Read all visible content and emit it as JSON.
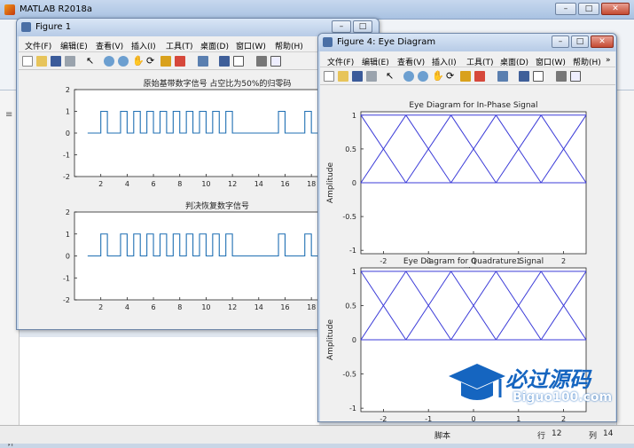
{
  "main_window": {
    "title": "MATLAB R2018a",
    "status_script": "脚本",
    "status_row_label": "行",
    "status_row": "12",
    "status_col_label": "列",
    "status_col": "14",
    "left_clip_label": "评"
  },
  "figure1": {
    "title": "Figure 1",
    "menu": [
      "文件(F)",
      "编辑(E)",
      "查看(V)",
      "插入(I)",
      "工具(T)",
      "桌面(D)",
      "窗口(W)",
      "帮助(H)"
    ],
    "plot1_title": "原始基带数字信号 占空比为50%的归零码",
    "plot2_title": "判决恢复数字信号",
    "yticks": [
      "2",
      "1",
      "0",
      "-1",
      "-2"
    ],
    "xticks": [
      "2",
      "4",
      "6",
      "8",
      "10",
      "12",
      "14",
      "16",
      "18"
    ]
  },
  "figure4": {
    "title": "Figure 4: Eye Diagram",
    "menu": [
      "文件(F)",
      "编辑(E)",
      "查看(V)",
      "插入(I)",
      "工具(T)",
      "桌面(D)",
      "窗口(W)",
      "帮助(H)"
    ],
    "plot1_title": "Eye Diagram for In-Phase Signal",
    "plot2_title": "Eye Diagram for Quadrature Signal",
    "ylabel": "Amplitude",
    "xlabel": "Time",
    "yticks": [
      "1",
      "0.5",
      "0",
      "-0.5",
      "-1"
    ],
    "xticks": [
      "-2",
      "-1",
      "0",
      "1",
      "2"
    ]
  },
  "watermark": {
    "brand": "必过源码",
    "url": "Biguo100.com"
  },
  "colors": {
    "signal": "#1f6fb3",
    "eye": "#3b3bd8",
    "accent_watermark": "#1565c0"
  }
}
